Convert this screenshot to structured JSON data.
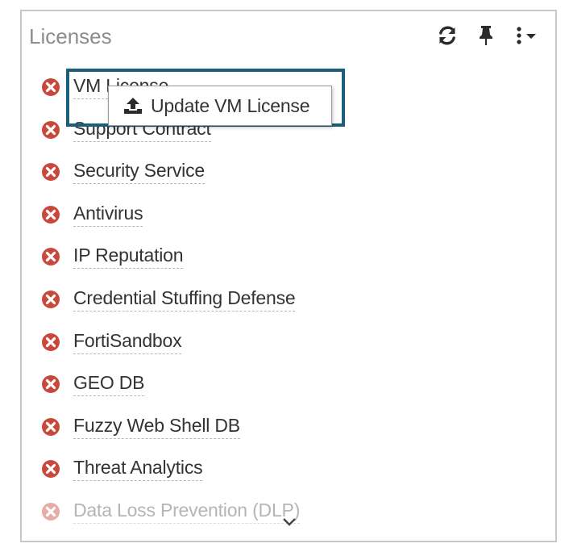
{
  "widget": {
    "title": "Licenses",
    "toolbar": {
      "refresh_icon": "refresh-icon",
      "pin_icon": "pin-icon",
      "menu_icon": "kebab-menu-icon"
    }
  },
  "licenses": [
    {
      "label": "VM License",
      "status": "invalid",
      "faded": false
    },
    {
      "label": "Support Contract",
      "status": "invalid",
      "faded": false
    },
    {
      "label": "Security Service",
      "status": "invalid",
      "faded": false
    },
    {
      "label": "Antivirus",
      "status": "invalid",
      "faded": false
    },
    {
      "label": "IP Reputation",
      "status": "invalid",
      "faded": false
    },
    {
      "label": "Credential Stuffing Defense",
      "status": "invalid",
      "faded": false
    },
    {
      "label": "FortiSandbox",
      "status": "invalid",
      "faded": false
    },
    {
      "label": "GEO DB",
      "status": "invalid",
      "faded": false
    },
    {
      "label": "Fuzzy Web Shell DB",
      "status": "invalid",
      "faded": false
    },
    {
      "label": "Threat Analytics",
      "status": "invalid",
      "faded": false
    },
    {
      "label": "Data Loss Prevention (DLP)",
      "status": "invalid",
      "faded": true
    }
  ],
  "tooltip": {
    "label": "Update VM License",
    "icon": "upload-icon"
  },
  "colors": {
    "error_red": "#c9483b",
    "highlight_border": "#1b5f7d",
    "text": "#333333",
    "title": "#8c8c8c"
  }
}
